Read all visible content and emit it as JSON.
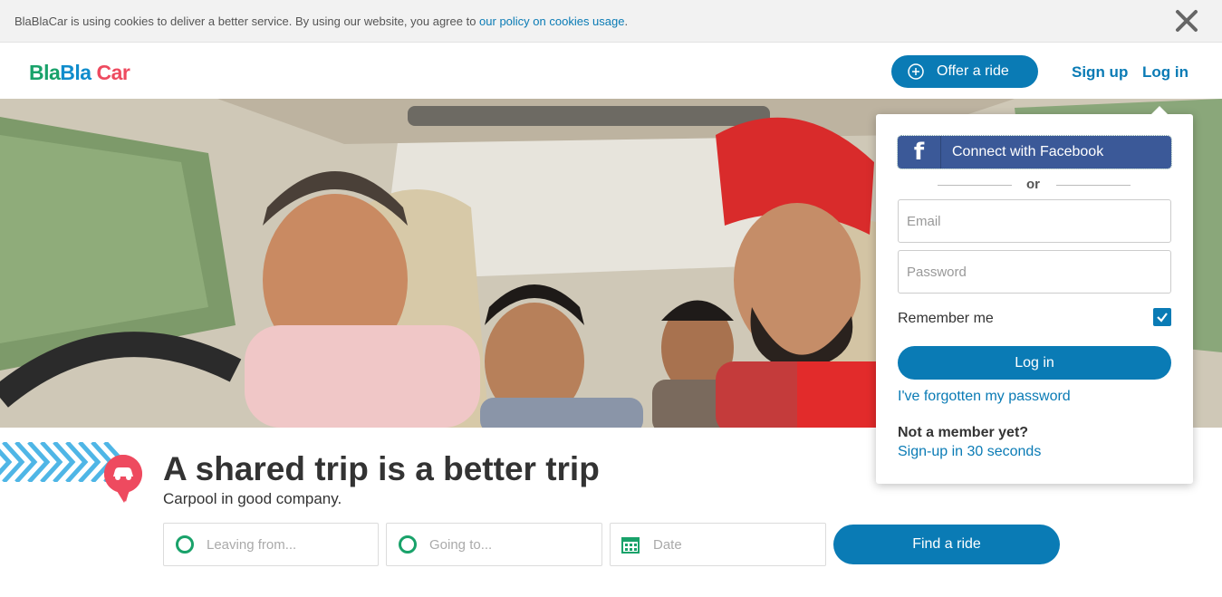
{
  "cookie_bar": {
    "text": "BlaBlaCar is using cookies to deliver a better service. By using our website, you agree to ",
    "link": "our policy on cookies usage",
    "end": "."
  },
  "header": {
    "logo": {
      "part1": "Bla",
      "part2": "Bla",
      "part3": "Car"
    },
    "offer_button": "Offer a ride",
    "signup": "Sign up",
    "login": "Log in"
  },
  "hero": {
    "tagline": "A shared trip is a better trip",
    "subtagline": "Carpool in good company."
  },
  "search": {
    "from_placeholder": "Leaving from...",
    "to_placeholder": "Going to...",
    "date_placeholder": "Date",
    "find_button": "Find a ride"
  },
  "login_panel": {
    "facebook_button": "Connect with Facebook",
    "or": "or",
    "email_placeholder": "Email",
    "password_placeholder": "Password",
    "remember_me": "Remember me",
    "remember_checked": true,
    "login_button": "Log in",
    "forgot_password": "I've forgotten my password",
    "not_member": "Not a member yet?",
    "signup_link": "Sign-up in 30 seconds"
  },
  "colors": {
    "brand_blue": "#0a7bb5",
    "brand_green": "#19a26a",
    "brand_red": "#ee4a5f",
    "facebook": "#3b5998"
  }
}
